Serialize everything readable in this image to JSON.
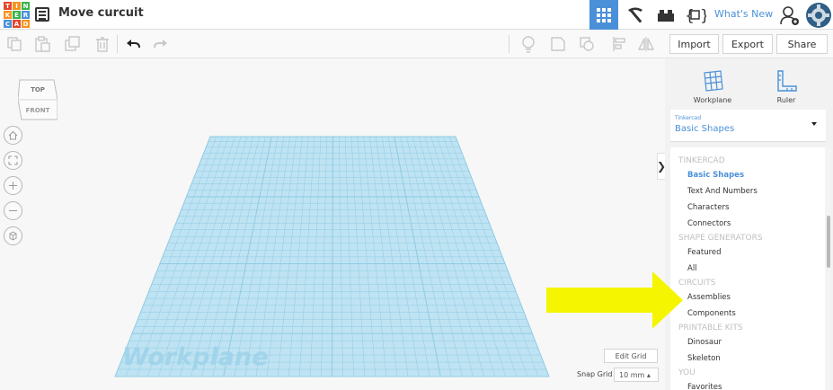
{
  "app": {
    "logo_letters": [
      "T",
      "I",
      "N",
      "K",
      "E",
      "R",
      "C",
      "A",
      "D"
    ],
    "logo_colors": [
      "#e2462c",
      "#f8921e",
      "#38b449",
      "#f8921e",
      "#38b449",
      "#4a90d9",
      "#4a90d9",
      "#e2462c",
      "#f8921e"
    ],
    "title": "Move curcuit"
  },
  "topbar": {
    "whats_new": "What's New",
    "icons": [
      "grid-view-icon",
      "pickaxe-icon",
      "bricks-icon",
      "code-blocks-icon",
      "add-user-icon",
      "avatar"
    ]
  },
  "toolbar": {
    "icons": [
      "copy-icon",
      "paste-icon",
      "duplicate-icon",
      "delete-icon",
      "undo-icon",
      "redo-icon",
      "light-icon",
      "note-icon",
      "group-icon",
      "align-icon",
      "mirror-icon"
    ],
    "import": "Import",
    "export": "Export",
    "share": "Share"
  },
  "viewport": {
    "cube_top": "TOP",
    "cube_front": "FRONT",
    "nav_icons": [
      "home-icon",
      "fit-icon",
      "zoom-in-icon",
      "zoom-out-icon",
      "perspective-icon"
    ],
    "workplane_label": "Workplane",
    "edit_grid": "Edit Grid",
    "snap_grid_label": "Snap Grid",
    "snap_grid_value": "10 mm ▴",
    "collapse_icon": "❯"
  },
  "panel": {
    "tool_workplane": "Workplane",
    "tool_ruler": "Ruler",
    "library_small": "Tinkercad",
    "library_selected": "Basic Shapes",
    "sections": [
      {
        "header": "TINKERCAD",
        "items": [
          "Basic Shapes",
          "Text And Numbers",
          "Characters",
          "Connectors"
        ]
      },
      {
        "header": "SHAPE GENERATORS",
        "items": [
          "Featured",
          "All"
        ]
      },
      {
        "header": "CIRCUITS",
        "items": [
          "Assemblies",
          "Components"
        ]
      },
      {
        "header": "PRINTABLE KITS",
        "items": [
          "Dinosaur",
          "Skeleton"
        ]
      },
      {
        "header": "YOU",
        "items": [
          "Favorites"
        ]
      }
    ]
  },
  "colors": {
    "accent": "#4a90d9",
    "grid_fill": "#bfe3f2",
    "grid_line": "#7dc3e0",
    "arrow": "#f5f500"
  }
}
